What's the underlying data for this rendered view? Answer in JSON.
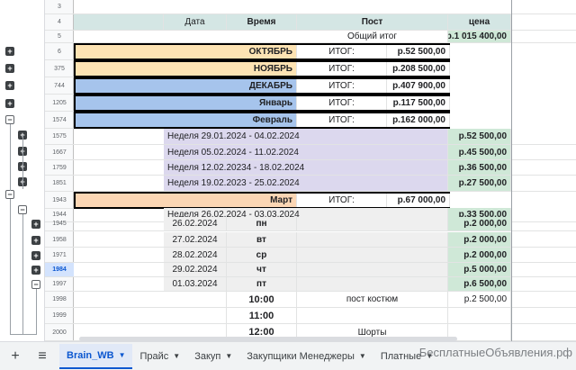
{
  "colors": {
    "header_bg": "#d4e6e4",
    "green": "#cfe8d7",
    "orange": "#fde3b3",
    "blue": "#a6c4ec",
    "lavender": "#dcd8ee",
    "grey": "#efefef",
    "light_orange": "#fbd6b4",
    "white": "#ffffff"
  },
  "header": {
    "date": "Дата",
    "time": "Время",
    "post": "Пост",
    "price": "цена",
    "total_label": "Общий итог",
    "total_value": "р.1 015 400,00"
  },
  "row_numbers": [
    "3",
    "4",
    "5",
    "6",
    "375",
    "744",
    "1205",
    "1574",
    "1575",
    "1667",
    "1759",
    "1851",
    "1943",
    "1944",
    "1945",
    "1958",
    "1971",
    "1984",
    "1997",
    "1998",
    "1999",
    "2000"
  ],
  "months": [
    {
      "name": "ОКТЯБРЬ",
      "itog": "ИТОГ:",
      "value": "р.52 500,00"
    },
    {
      "name": "НОЯБРЬ",
      "itog": "ИТОГ:",
      "value": "р.208 500,00"
    },
    {
      "name": "ДЕКАБРЬ",
      "itog": "ИТОГ:",
      "value": "р.407 900,00"
    },
    {
      "name": "Январь",
      "itog": "ИТОГ:",
      "value": "р.117 500,00"
    },
    {
      "name": "Февраль",
      "itog": "ИТОГ:",
      "value": "р.162 000,00"
    }
  ],
  "weeks": [
    {
      "label": "Неделя 29.01.2024 - 04.02.2024",
      "value": "р.52 500,00"
    },
    {
      "label": "Неделя 05.02.2024 - 11.02.2024",
      "value": "р.45 500,00"
    },
    {
      "label": "Неделя 12.02.20234 - 18.02.2024",
      "value": "р.36 500,00"
    },
    {
      "label": "Неделя 19.02.2023 - 25.02.2024",
      "value": "р.27 500,00"
    }
  ],
  "march": {
    "name": "Март",
    "itog": "ИТОГ:",
    "value": "р.67 000,00"
  },
  "march_week": {
    "label": "Неделя 26.02.2024 - 03.03.2024",
    "value": "р.33 500,00"
  },
  "days": [
    {
      "date": "26.02.2024",
      "day": "пн",
      "value": "р.2 000,00"
    },
    {
      "date": "27.02.2024",
      "day": "вт",
      "value": "р.2 000,00"
    },
    {
      "date": "28.02.2024",
      "day": "ср",
      "value": "р.2 000,00"
    },
    {
      "date": "29.02.2024",
      "day": "чт",
      "value": "р.5 000,00"
    },
    {
      "date": "01.03.2024",
      "day": "пт",
      "value": "р.6 500,00"
    }
  ],
  "slots": [
    {
      "time": "10:00",
      "post": "пост костюм",
      "value": "р.2 500,00"
    },
    {
      "time": "11:00",
      "post": "",
      "value": ""
    },
    {
      "time": "12:00",
      "post": "Шорты",
      "value": ""
    }
  ],
  "tabs": [
    {
      "label": "Brain_WB",
      "active": true
    },
    {
      "label": "Прайс",
      "active": false
    },
    {
      "label": "Закуп",
      "active": false
    },
    {
      "label": "Закупщики Менеджеры",
      "active": false
    },
    {
      "label": "Платные",
      "active": false
    }
  ],
  "toolbar": {
    "add_icon": "plus-icon",
    "menu_icon": "menu-icon"
  },
  "watermark": "БесплатныеОбъявления.рф"
}
